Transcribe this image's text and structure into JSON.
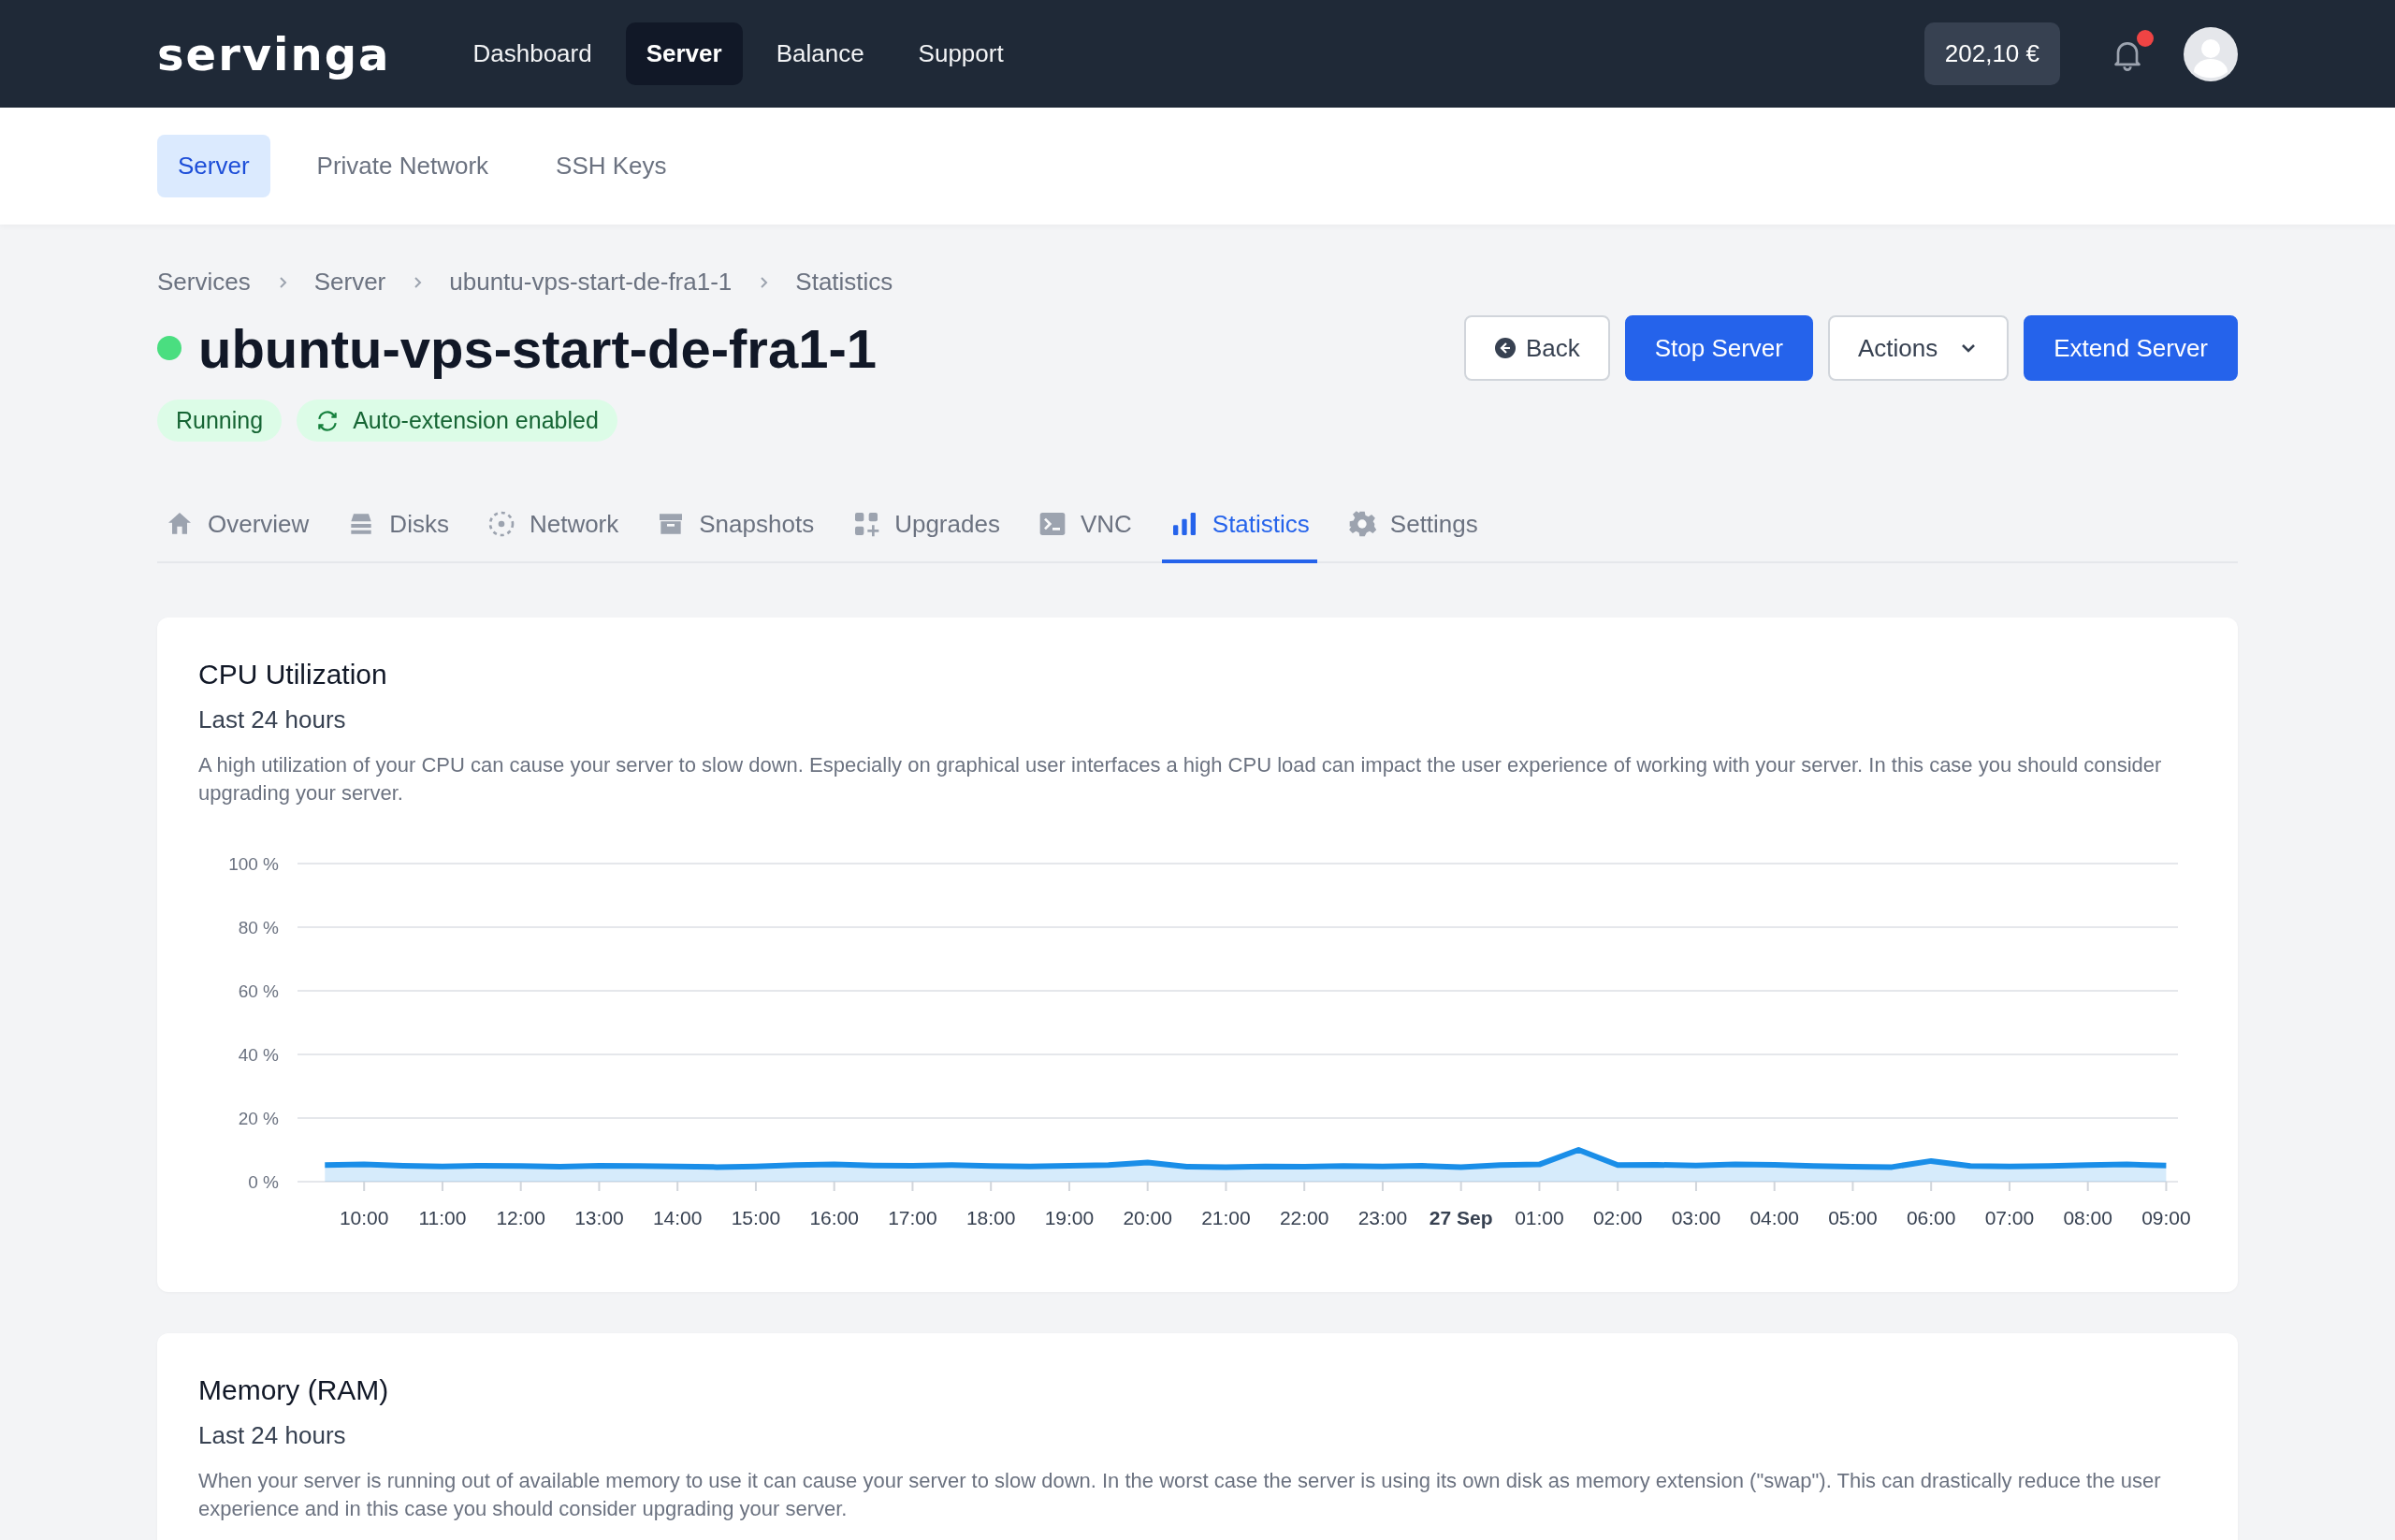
{
  "topbar": {
    "logo": "servinga",
    "nav": [
      {
        "label": "Dashboard",
        "selected": false
      },
      {
        "label": "Server",
        "selected": true
      },
      {
        "label": "Balance",
        "selected": false
      },
      {
        "label": "Support",
        "selected": false
      }
    ],
    "balance": "202,10 €",
    "has_notification": true
  },
  "subnav": [
    {
      "label": "Server",
      "selected": true
    },
    {
      "label": "Private Network",
      "selected": false
    },
    {
      "label": "SSH Keys",
      "selected": false
    }
  ],
  "breadcrumb": [
    "Services",
    "Server",
    "ubuntu-vps-start-de-fra1-1",
    "Statistics"
  ],
  "server": {
    "name": "ubuntu-vps-start-de-fra1-1",
    "online": true,
    "badges": [
      {
        "kind": "status",
        "label": "Running"
      },
      {
        "kind": "renew",
        "label": "Auto-extension enabled"
      }
    ]
  },
  "actions": [
    {
      "kind": "back",
      "label": "Back"
    },
    {
      "kind": "primary",
      "label": "Stop Server"
    },
    {
      "kind": "dropdown",
      "label": "Actions"
    },
    {
      "kind": "primary",
      "label": "Extend Server"
    }
  ],
  "tabs": [
    {
      "kind": "home",
      "label": "Overview",
      "selected": false
    },
    {
      "kind": "stack",
      "label": "Disks",
      "selected": false
    },
    {
      "kind": "network",
      "label": "Network",
      "selected": false
    },
    {
      "kind": "archive",
      "label": "Snapshots",
      "selected": false
    },
    {
      "kind": "grid",
      "label": "Upgrades",
      "selected": false
    },
    {
      "kind": "terminal",
      "label": "VNC",
      "selected": false
    },
    {
      "kind": "bars",
      "label": "Statistics",
      "selected": true
    },
    {
      "kind": "gear",
      "label": "Settings",
      "selected": false
    }
  ],
  "cards": [
    {
      "title": "CPU Utilization",
      "subtitle": "Last 24 hours",
      "description": "A high utilization of your CPU can cause your server to slow down. Especially on graphical user interfaces a high CPU load can impact the user experience of working with your server. In this case you should consider upgrading your server.",
      "chart_data": {
        "type": "area",
        "categories": [
          null,
          "10:00",
          null,
          "11:00",
          null,
          "12:00",
          null,
          "13:00",
          null,
          "14:00",
          null,
          "15:00",
          null,
          "16:00",
          null,
          "17:00",
          null,
          "18:00",
          null,
          "19:00",
          null,
          "20:00",
          null,
          "21:00",
          null,
          "22:00",
          null,
          "23:00",
          null,
          "27 Sep",
          null,
          "01:00",
          null,
          "02:00",
          null,
          "03:00",
          null,
          "04:00",
          null,
          "05:00",
          null,
          "06:00",
          null,
          "07:00",
          null,
          "08:00",
          null,
          "09:00"
        ],
        "series": [
          {
            "color": "#1a8ee8",
            "values": [
              5.2,
              5.4,
              5,
              4.8,
              5,
              4.9,
              4.7,
              5,
              4.9,
              4.8,
              4.6,
              4.8,
              5.2,
              5.4,
              5.1,
              5,
              5.2,
              4.9,
              4.8,
              5,
              5.2,
              6,
              4.7,
              4.6,
              4.8,
              4.7,
              4.9,
              4.8,
              5,
              4.6,
              5.2,
              5.4,
              10,
              5.2,
              5.3,
              5.1,
              5.4,
              5.3,
              4.9,
              4.7,
              4.6,
              6.5,
              4.9,
              4.8,
              4.9,
              5.2,
              5.4,
              5.1
            ]
          }
        ],
        "ylim": [
          0,
          100
        ],
        "grid": true,
        "yticks": [
          {
            "value": 0,
            "label": "0 %"
          },
          {
            "value": 20,
            "label": "20 %"
          },
          {
            "value": 40,
            "label": "40 %"
          },
          {
            "value": 60,
            "label": "60 %"
          },
          {
            "value": 80,
            "label": "80 %"
          },
          {
            "value": 100,
            "label": "100 %"
          }
        ]
      }
    },
    {
      "title": "Memory (RAM)",
      "subtitle": "Last 24 hours",
      "description": "When your server is running out of available memory to use it can cause your server to slow down. In the worst case the server is using its own disk as memory extension (\"swap\"). This can drastically reduce the user experience and in this case you should consider upgrading your server."
    }
  ]
}
